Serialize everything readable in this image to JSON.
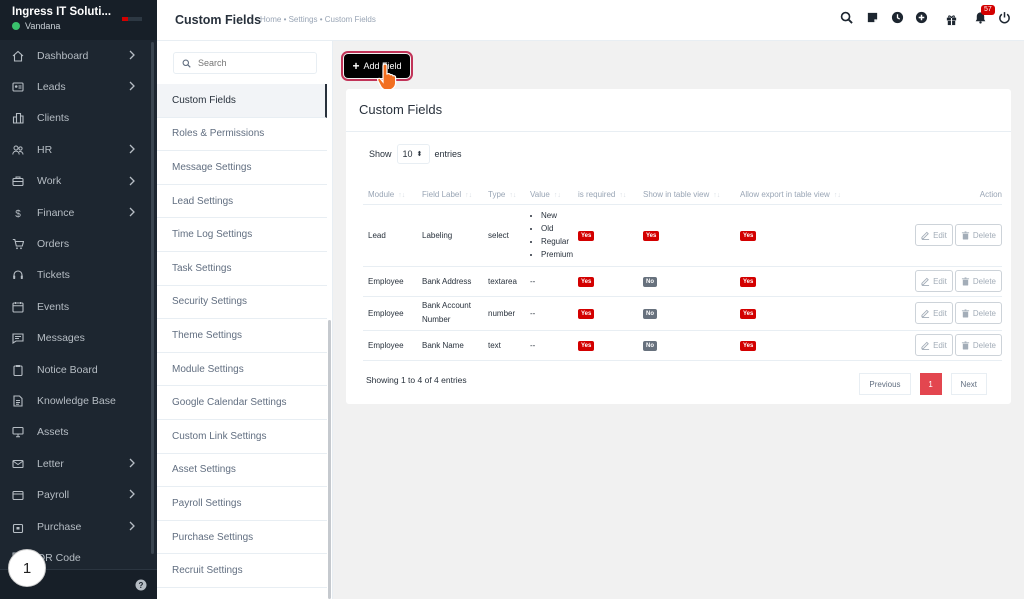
{
  "sidebar": {
    "company": "Ingress IT Soluti...",
    "user": "Vandana",
    "items": [
      {
        "label": "Dashboard",
        "icon": "house-icon",
        "has_children": true
      },
      {
        "label": "Leads",
        "icon": "id-card-icon",
        "has_children": true
      },
      {
        "label": "Clients",
        "icon": "building-icon",
        "has_children": false
      },
      {
        "label": "HR",
        "icon": "people-icon",
        "has_children": true
      },
      {
        "label": "Work",
        "icon": "briefcase-icon",
        "has_children": true
      },
      {
        "label": "Finance",
        "icon": "dollar-icon",
        "has_children": true
      },
      {
        "label": "Orders",
        "icon": "cart-icon",
        "has_children": false
      },
      {
        "label": "Tickets",
        "icon": "headset-icon",
        "has_children": false
      },
      {
        "label": "Events",
        "icon": "calendar-icon",
        "has_children": false
      },
      {
        "label": "Messages",
        "icon": "chat-icon",
        "has_children": false
      },
      {
        "label": "Notice Board",
        "icon": "clipboard-icon",
        "has_children": false
      },
      {
        "label": "Knowledge Base",
        "icon": "document-icon",
        "has_children": false
      },
      {
        "label": "Assets",
        "icon": "monitor-icon",
        "has_children": false
      },
      {
        "label": "Letter",
        "icon": "envelope-icon",
        "has_children": true
      },
      {
        "label": "Payroll",
        "icon": "wallet-icon",
        "has_children": true
      },
      {
        "label": "Purchase",
        "icon": "bag-icon",
        "has_children": true
      },
      {
        "label": "QR Code",
        "icon": "qr-icon",
        "has_children": false
      }
    ],
    "step_badge": "1"
  },
  "header": {
    "title": "Custom Fields",
    "breadcrumb": "Home • Settings • Custom Fields",
    "notification_count": "57",
    "icons": [
      "search-icon",
      "sticky-note-icon",
      "clock-icon",
      "plus-circle-icon",
      "gift-icon",
      "bell-icon",
      "power-icon"
    ]
  },
  "settings_menu": {
    "search_placeholder": "Search",
    "items": [
      "Custom Fields",
      "Roles & Permissions",
      "Message Settings",
      "Lead Settings",
      "Time Log Settings",
      "Task Settings",
      "Security Settings",
      "Theme Settings",
      "Module Settings",
      "Google Calendar Settings",
      "Custom Link Settings",
      "Asset Settings",
      "Payroll Settings",
      "Purchase Settings",
      "Recruit Settings"
    ],
    "active_index": 0
  },
  "toolbar": {
    "add_label": "Add Field"
  },
  "card": {
    "title": "Custom Fields",
    "show_label": "Show",
    "entries_value": "10",
    "entries_label": "entries",
    "columns": [
      "Module",
      "Field Label",
      "Type",
      "Value",
      "is required",
      "Show in table view",
      "Allow export in table view",
      "Action"
    ],
    "rows": [
      {
        "module": "Lead",
        "label": "Labeling",
        "type": "select",
        "values": [
          "New",
          "Old",
          "Regular",
          "Premium"
        ],
        "required": "Yes",
        "table_view": "Yes",
        "export": "Yes"
      },
      {
        "module": "Employee",
        "label": "Bank Address",
        "type": "textarea",
        "value": "--",
        "required": "Yes",
        "table_view": "No",
        "export": "Yes"
      },
      {
        "module": "Employee",
        "label": "Bank Account Number",
        "type": "number",
        "value": "--",
        "required": "Yes",
        "table_view": "No",
        "export": "Yes"
      },
      {
        "module": "Employee",
        "label": "Bank Name",
        "type": "text",
        "value": "--",
        "required": "Yes",
        "table_view": "No",
        "export": "Yes"
      }
    ],
    "edit_label": "Edit",
    "delete_label": "Delete",
    "showing": "Showing 1 to 4 of 4 entries",
    "prev_label": "Previous",
    "current_page": "1",
    "next_label": "Next"
  },
  "colors": {
    "sidebar_bg": "#1d2630",
    "accent_red": "#d30000",
    "page_active": "#e3464f",
    "highlight": "#c13358"
  }
}
